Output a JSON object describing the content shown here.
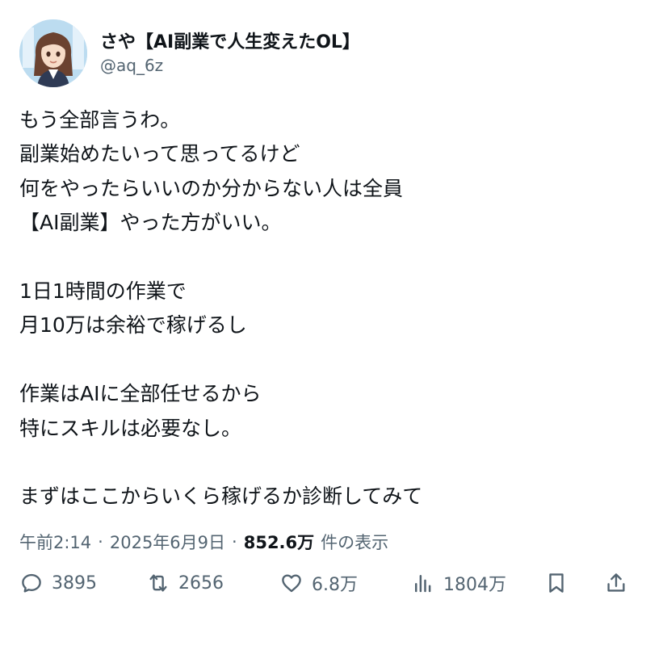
{
  "author": {
    "display_name": "さや【AI副業で人生変えたOL】",
    "handle": "@aq_6z",
    "avatar_icon": "avatar-illustration-icon"
  },
  "post": {
    "lines": [
      "もう全部言うわ。",
      "副業始めたいって思ってるけど",
      "何をやったらいいのか分からない人は全員",
      "【AI副業】やった方がいい。",
      "",
      "1日1時間の作業で",
      "月10万は余裕で稼げるし",
      "",
      "作業はAIに全部任せるから",
      "特にスキルは必要なし。",
      "",
      "まずはここからいくら稼げるか診断してみて"
    ]
  },
  "meta": {
    "time": "午前2:14",
    "separator": "·",
    "date": "2025年6月9日",
    "views": "852.6万",
    "views_label": "件の表示"
  },
  "actions": {
    "replies": "3895",
    "reposts": "2656",
    "likes": "6.8万",
    "views": "1804万"
  },
  "colors": {
    "text": "#0f1419",
    "secondary": "#536471",
    "background": "#ffffff"
  }
}
